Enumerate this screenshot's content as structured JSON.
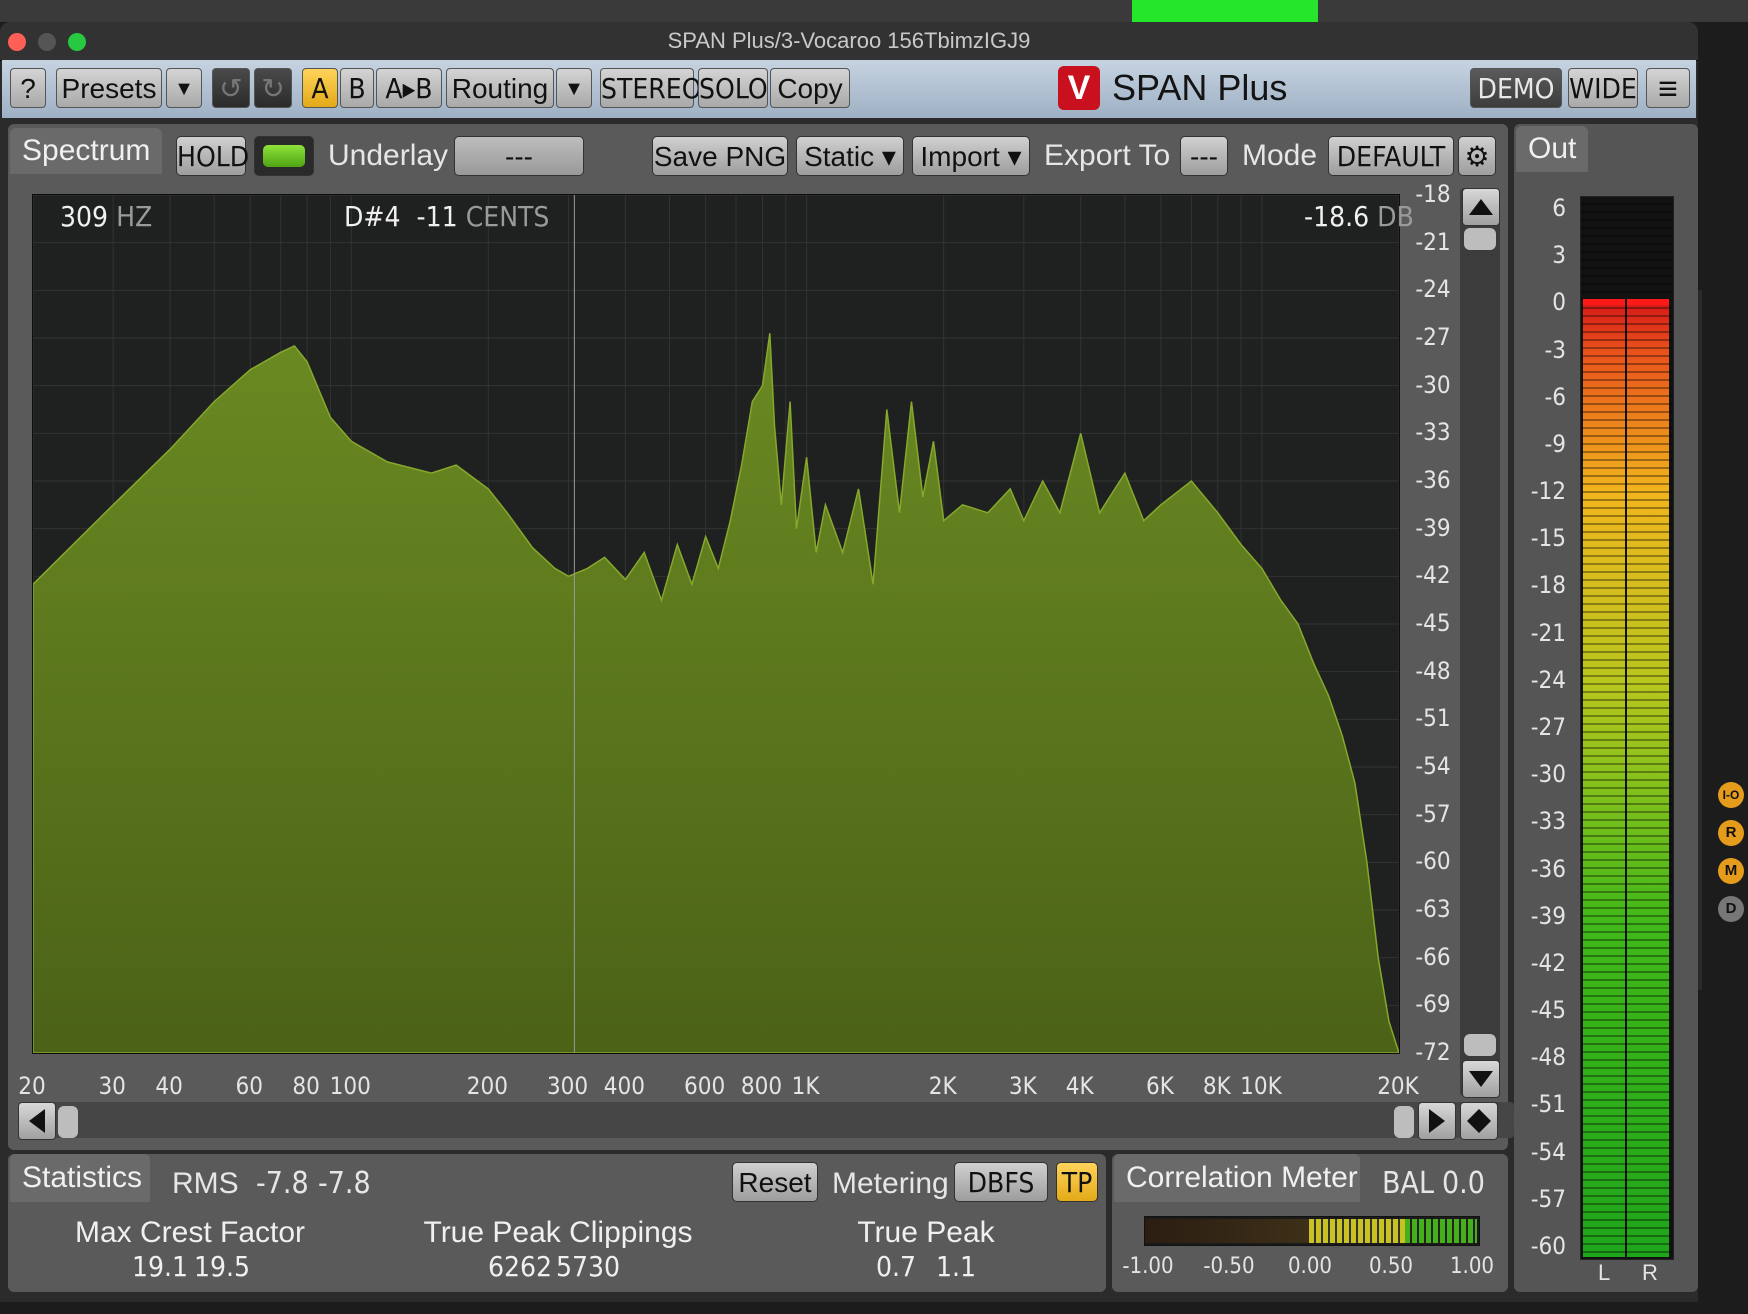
{
  "window": {
    "title": "SPAN Plus/3-Vocaroo 156TbimzIGJ9"
  },
  "toolbar": {
    "help": "?",
    "presets": "Presets",
    "dropdown_arrow": "▼",
    "undo": "↺",
    "redo": "↻",
    "a": "A",
    "b": "B",
    "ab": "A▸B",
    "routing": "Routing",
    "stereo": "STEREO",
    "solo": "SOLO",
    "copy": "Copy",
    "brand": "SPAN Plus",
    "logo_glyph": "V",
    "demo": "DEMO",
    "wide": "WIDE",
    "menu": "≡"
  },
  "spectrum": {
    "tab": "Spectrum",
    "hold": "HOLD",
    "underlay_label": "Underlay",
    "underlay_value": "---",
    "save_png": "Save PNG",
    "static": "Static ▾",
    "import": "Import ▾",
    "export_label": "Export To",
    "export_value": "---",
    "mode_label": "Mode",
    "mode_value": "DEFAULT",
    "readout": {
      "freq_value": "309",
      "freq_unit": "HZ",
      "note": "D#4",
      "cents_value": "-11",
      "cents_unit": "CENTS",
      "db_value": "-18.6",
      "db_unit": "DB"
    },
    "y_ticks": [
      "-18",
      "-21",
      "-24",
      "-27",
      "-30",
      "-33",
      "-36",
      "-39",
      "-42",
      "-45",
      "-48",
      "-51",
      "-54",
      "-57",
      "-60",
      "-63",
      "-66",
      "-69",
      "-72"
    ],
    "x_ticks": [
      "20",
      "30",
      "40",
      "60",
      "80",
      "100",
      "200",
      "300",
      "400",
      "600",
      "800",
      "1K",
      "2K",
      "3K",
      "4K",
      "6K",
      "8K",
      "10K",
      "20K"
    ]
  },
  "chart_data": {
    "type": "area",
    "xlabel": "",
    "ylabel": "",
    "x_scale": "log",
    "x": [
      20,
      30,
      40,
      50,
      60,
      70,
      75,
      80,
      90,
      100,
      120,
      150,
      170,
      200,
      220,
      250,
      280,
      300,
      330,
      360,
      400,
      440,
      480,
      520,
      560,
      600,
      640,
      680,
      720,
      760,
      800,
      830,
      850,
      880,
      920,
      950,
      1000,
      1050,
      1100,
      1200,
      1300,
      1400,
      1500,
      1600,
      1700,
      1800,
      1900,
      2000,
      2200,
      2500,
      2800,
      3000,
      3300,
      3600,
      4000,
      4400,
      5000,
      5500,
      6000,
      7000,
      8000,
      9000,
      10000,
      11000,
      12000,
      13000,
      14000,
      15000,
      16000,
      17000,
      18000,
      19000,
      20000
    ],
    "y": [
      -42.5,
      -37.5,
      -34.0,
      -31.0,
      -29.0,
      -27.9,
      -27.5,
      -28.5,
      -32.0,
      -33.5,
      -34.8,
      -35.5,
      -35.0,
      -36.5,
      -38.0,
      -40.2,
      -41.5,
      -42.0,
      -41.5,
      -40.8,
      -42.2,
      -40.5,
      -43.5,
      -40.0,
      -42.5,
      -39.5,
      -41.5,
      -38.5,
      -35.0,
      -31.0,
      -30.0,
      -26.7,
      -32.5,
      -37.5,
      -31.0,
      -39.0,
      -34.5,
      -40.5,
      -37.5,
      -40.5,
      -36.5,
      -42.5,
      -31.5,
      -38.0,
      -31.0,
      -37.0,
      -33.5,
      -38.5,
      -37.5,
      -38.0,
      -36.5,
      -38.5,
      -36.0,
      -38.0,
      -33.0,
      -38.0,
      -35.5,
      -38.5,
      -37.5,
      -36.0,
      -38.0,
      -40.0,
      -41.5,
      -43.5,
      -45.0,
      -47.5,
      -49.5,
      -52.0,
      -55.0,
      -60.0,
      -66.0,
      -70.0,
      -72.0
    ],
    "xlim": [
      20,
      20000
    ],
    "ylim": [
      -72,
      -18
    ],
    "color": "#5f7a1f"
  },
  "stats": {
    "tab": "Statistics",
    "rms_label": "RMS",
    "rms_l": "-7.8",
    "rms_r": "-7.8",
    "reset": "Reset",
    "metering_label": "Metering",
    "dbfs": "DBFS",
    "tp": "TP",
    "crest_label": "Max Crest Factor",
    "crest_l": "19.1",
    "crest_r": "19.5",
    "clip_label": "True Peak Clippings",
    "clip_l": "6262",
    "clip_r": "5730",
    "tpeak_label": "True Peak",
    "tpeak_l": "0.7",
    "tpeak_r": "1.1"
  },
  "correlation": {
    "tab": "Correlation Meter",
    "bal_label": "BAL",
    "bal_value": "0.0",
    "ticks": [
      "-1.00",
      "-0.50",
      "0.00",
      "0.50",
      "1.00"
    ]
  },
  "out": {
    "tab": "Out",
    "ticks": [
      "6",
      "3",
      "0",
      "-3",
      "-6",
      "-9",
      "-12",
      "-15",
      "-18",
      "-21",
      "-24",
      "-27",
      "-30",
      "-33",
      "-36",
      "-39",
      "-42",
      "-45",
      "-48",
      "-51",
      "-54",
      "-57",
      "-60"
    ],
    "ch_l": "L",
    "ch_r": "R",
    "peak_level": 0.0
  },
  "side": {
    "io": "I-O",
    "r": "R",
    "m": "M",
    "d": "D"
  },
  "colors": {
    "spectrum_fill": "#5f7a1f",
    "accent_gold": "#f2be2a",
    "toolbar_blue": "#b2c2d4"
  }
}
